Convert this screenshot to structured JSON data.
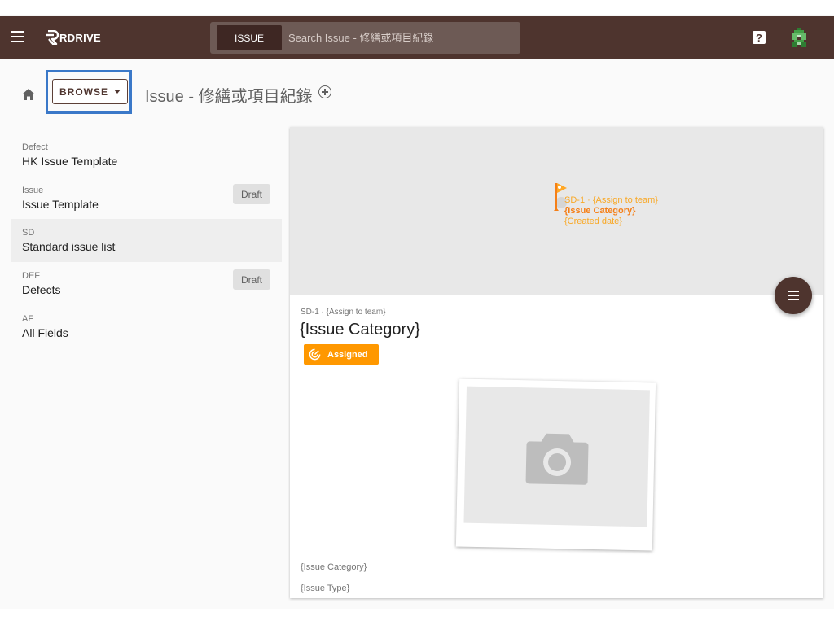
{
  "topbar": {
    "logo_text": "RDRIVE",
    "search_scope": "ISSUE",
    "search_placeholder": "Search Issue - 修繕或項目紀錄",
    "help_glyph": "?"
  },
  "header": {
    "browse_label": "BROWSE",
    "page_title": "Issue - 修繕或項目紀錄"
  },
  "sidebar": {
    "items": [
      {
        "code": "Defect",
        "name": "HK Issue Template",
        "badge": ""
      },
      {
        "code": "Issue",
        "name": "Issue Template",
        "badge": "Draft"
      },
      {
        "code": "SD",
        "name": "Standard issue list",
        "badge": ""
      },
      {
        "code": "DEF",
        "name": "Defects",
        "badge": "Draft"
      },
      {
        "code": "AF",
        "name": "All Fields",
        "badge": ""
      }
    ],
    "selected_index": 2
  },
  "card": {
    "map_line1": "SD-1 · {Assign to team}",
    "map_line2": "{Issue Category}",
    "map_line3": "{Created date}",
    "subtitle": "SD-1 · {Assign to team}",
    "title": "{Issue Category}",
    "status": "Assigned",
    "fields": [
      "{Issue Category}",
      "{Issue Type}"
    ]
  },
  "icons": {
    "menu": "menu-icon",
    "home": "home-icon",
    "add": "add-circle-icon",
    "help": "help-icon",
    "fab": "menu-fab-icon",
    "status": "target-icon",
    "photo_placeholder": "camera-icon",
    "map_marker": "flag-icon"
  },
  "colors": {
    "topbar": "#4e342e",
    "accent": "#ff9800",
    "highlight": "#3a78c8"
  }
}
